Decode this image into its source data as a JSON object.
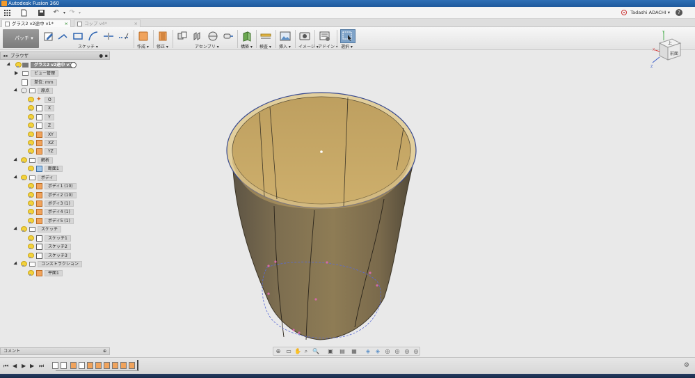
{
  "window": {
    "title": "Autodesk Fusion 360"
  },
  "user": {
    "name": "Tadashi ADACHI"
  },
  "tabs": [
    {
      "label": "グラス2 v2途中 v1*",
      "active": true
    },
    {
      "label": "コップ v4*",
      "active": false
    }
  ],
  "toolbar": {
    "workspace": "パッチ",
    "groups": [
      {
        "label": "スケッチ"
      },
      {
        "label": "作成"
      },
      {
        "label": "修正"
      },
      {
        "label": "アセンブリ"
      },
      {
        "label": "構築"
      },
      {
        "label": "検査"
      },
      {
        "label": "挿入"
      },
      {
        "label": "イメージ"
      },
      {
        "label": "アドイン"
      },
      {
        "label": "選択"
      }
    ]
  },
  "browser": {
    "title": "ブラウザ",
    "root": "グラス2 v2途中 v1",
    "items": [
      {
        "label": "ビュー管理"
      },
      {
        "label": "単位: mm"
      },
      {
        "label": "原点"
      },
      {
        "label": "O"
      },
      {
        "label": "X"
      },
      {
        "label": "Y"
      },
      {
        "label": "Z"
      },
      {
        "label": "XY"
      },
      {
        "label": "XZ"
      },
      {
        "label": "YZ"
      },
      {
        "label": "解析"
      },
      {
        "label": "断面1"
      },
      {
        "label": "ボディ"
      },
      {
        "label": "ボディ1 (10)"
      },
      {
        "label": "ボディ2 (10)"
      },
      {
        "label": "ボディ3 (1)"
      },
      {
        "label": "ボディ4 (1)"
      },
      {
        "label": "ボディ5 (1)"
      },
      {
        "label": "スケッチ"
      },
      {
        "label": "スケッチ1"
      },
      {
        "label": "スケッチ2"
      },
      {
        "label": "スケッチ3"
      },
      {
        "label": "コンストラクション"
      },
      {
        "label": "平面1"
      }
    ]
  },
  "comments": {
    "label": "コメント"
  },
  "viewcube": {
    "top": "上",
    "front": "前面",
    "axis_x": "X",
    "axis_y": "Y",
    "axis_z": "Z"
  },
  "colors": {
    "accent": "#2f6fb5",
    "body_outer": "#8c7a50",
    "body_inner": "#c9a861",
    "rim": "#e6d2a2"
  }
}
